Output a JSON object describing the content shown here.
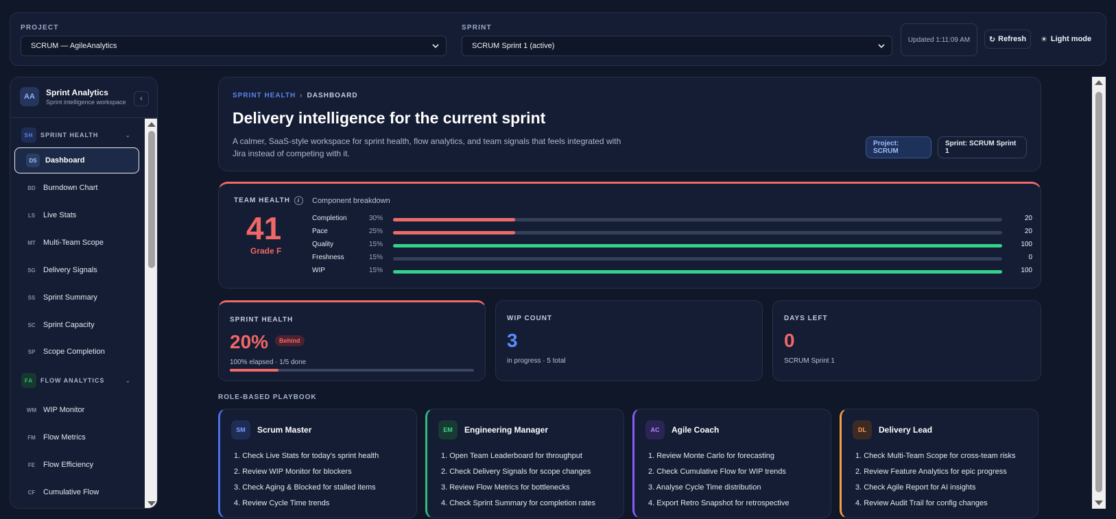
{
  "topbar": {
    "project_label": "PROJECT",
    "project_value": "SCRUM — AgileAnalytics",
    "sprint_label": "SPRINT",
    "sprint_value": "SCRUM Sprint 1 (active)",
    "updated": "Updated 1:11:09 AM",
    "refresh": "Refresh",
    "light_mode": "Light mode"
  },
  "sidebar": {
    "brand_initials": "AA",
    "brand_title": "Sprint Analytics",
    "brand_sub": "Sprint intelligence workspace",
    "sections": [
      {
        "abbr": "SH",
        "label": "SPRINT HEALTH",
        "color": "#5b84f0",
        "items": [
          {
            "abbr": "DS",
            "label": "Dashboard"
          },
          {
            "abbr": "BD",
            "label": "Burndown Chart"
          },
          {
            "abbr": "LS",
            "label": "Live Stats"
          },
          {
            "abbr": "MT",
            "label": "Multi-Team Scope"
          },
          {
            "abbr": "SG",
            "label": "Delivery Signals"
          },
          {
            "abbr": "SS",
            "label": "Sprint Summary"
          },
          {
            "abbr": "SC",
            "label": "Sprint Capacity"
          },
          {
            "abbr": "SP",
            "label": "Scope Completion"
          }
        ]
      },
      {
        "abbr": "FA",
        "label": "FLOW ANALYTICS",
        "color": "#2fbf7e",
        "items": [
          {
            "abbr": "WM",
            "label": "WIP Monitor"
          },
          {
            "abbr": "FM",
            "label": "Flow Metrics"
          },
          {
            "abbr": "FE",
            "label": "Flow Efficiency"
          },
          {
            "abbr": "CF",
            "label": "Cumulative Flow"
          }
        ]
      }
    ]
  },
  "hero": {
    "crumb_section": "SPRINT HEALTH",
    "crumb_sep": "›",
    "crumb_page": "DASHBOARD",
    "title": "Delivery intelligence for the current sprint",
    "description": "A calmer, SaaS-style workspace for sprint health, flow analytics, and team signals that feels integrated with Jira instead of competing with it.",
    "chip_project": "Project: SCRUM",
    "chip_sprint": "Sprint: SCRUM Sprint 1"
  },
  "team_health": {
    "label": "TEAM HEALTH",
    "info": "i",
    "score": "41",
    "grade": "Grade F",
    "breakdown_title": "Component breakdown",
    "components": [
      {
        "name": "Completion",
        "weight": "30%",
        "value": 20,
        "color": "#ef6b6b"
      },
      {
        "name": "Pace",
        "weight": "25%",
        "value": 20,
        "color": "#ef6b6b"
      },
      {
        "name": "Quality",
        "weight": "15%",
        "value": 100,
        "color": "#34d28a"
      },
      {
        "name": "Freshness",
        "weight": "15%",
        "value": 0,
        "color": "#ef6b6b"
      },
      {
        "name": "WIP",
        "weight": "15%",
        "value": 100,
        "color": "#34d28a"
      }
    ]
  },
  "stats": {
    "sprint_health": {
      "label": "SPRINT HEALTH",
      "value": "20%",
      "badge": "Behind",
      "sub": "100% elapsed · 1/5 done",
      "progress": 0.2
    },
    "wip": {
      "label": "WIP COUNT",
      "value": "3",
      "sub": "in progress · 5 total"
    },
    "days_left": {
      "label": "DAYS LEFT",
      "value": "0",
      "sub": "SCRUM Sprint 1"
    }
  },
  "playbook": {
    "title": "ROLE-BASED PLAYBOOK",
    "roles": [
      {
        "abbr": "SM",
        "name": "Scrum Master",
        "color": "#4f6ff0",
        "badge_bg": "#1f2d55",
        "badge_fg": "#7f9cff",
        "steps": [
          "1. Check Live Stats for today's sprint health",
          "2. Review WIP Monitor for blockers",
          "3. Check Aging & Blocked for stalled items",
          "4. Review Cycle Time trends"
        ]
      },
      {
        "abbr": "EM",
        "name": "Engineering Manager",
        "color": "#2fbf7e",
        "badge_bg": "#183a33",
        "badge_fg": "#3fd494",
        "steps": [
          "1. Open Team Leaderboard for throughput",
          "2. Check Delivery Signals for scope changes",
          "3. Review Flow Metrics for bottlenecks",
          "4. Check Sprint Summary for completion rates"
        ]
      },
      {
        "abbr": "AC",
        "name": "Agile Coach",
        "color": "#8b5cf6",
        "badge_bg": "#2b2454",
        "badge_fg": "#a68bff",
        "steps": [
          "1. Review Monte Carlo for forecasting",
          "2. Check Cumulative Flow for WIP trends",
          "3. Analyse Cycle Time distribution",
          "4. Export Retro Snapshot for retrospective"
        ]
      },
      {
        "abbr": "DL",
        "name": "Delivery Lead",
        "color": "#f59e42",
        "badge_bg": "#3d2a22",
        "badge_fg": "#ff9a5a",
        "steps": [
          "1. Check Multi-Team Scope for cross-team risks",
          "2. Review Feature Analytics for epic progress",
          "3. Check Agile Report for AI insights",
          "4. Review Audit Trail for config changes"
        ]
      }
    ]
  },
  "colors": {
    "wip_value": "#5b8cff",
    "days_value": "#f06767",
    "danger": "#ef6b6b"
  }
}
